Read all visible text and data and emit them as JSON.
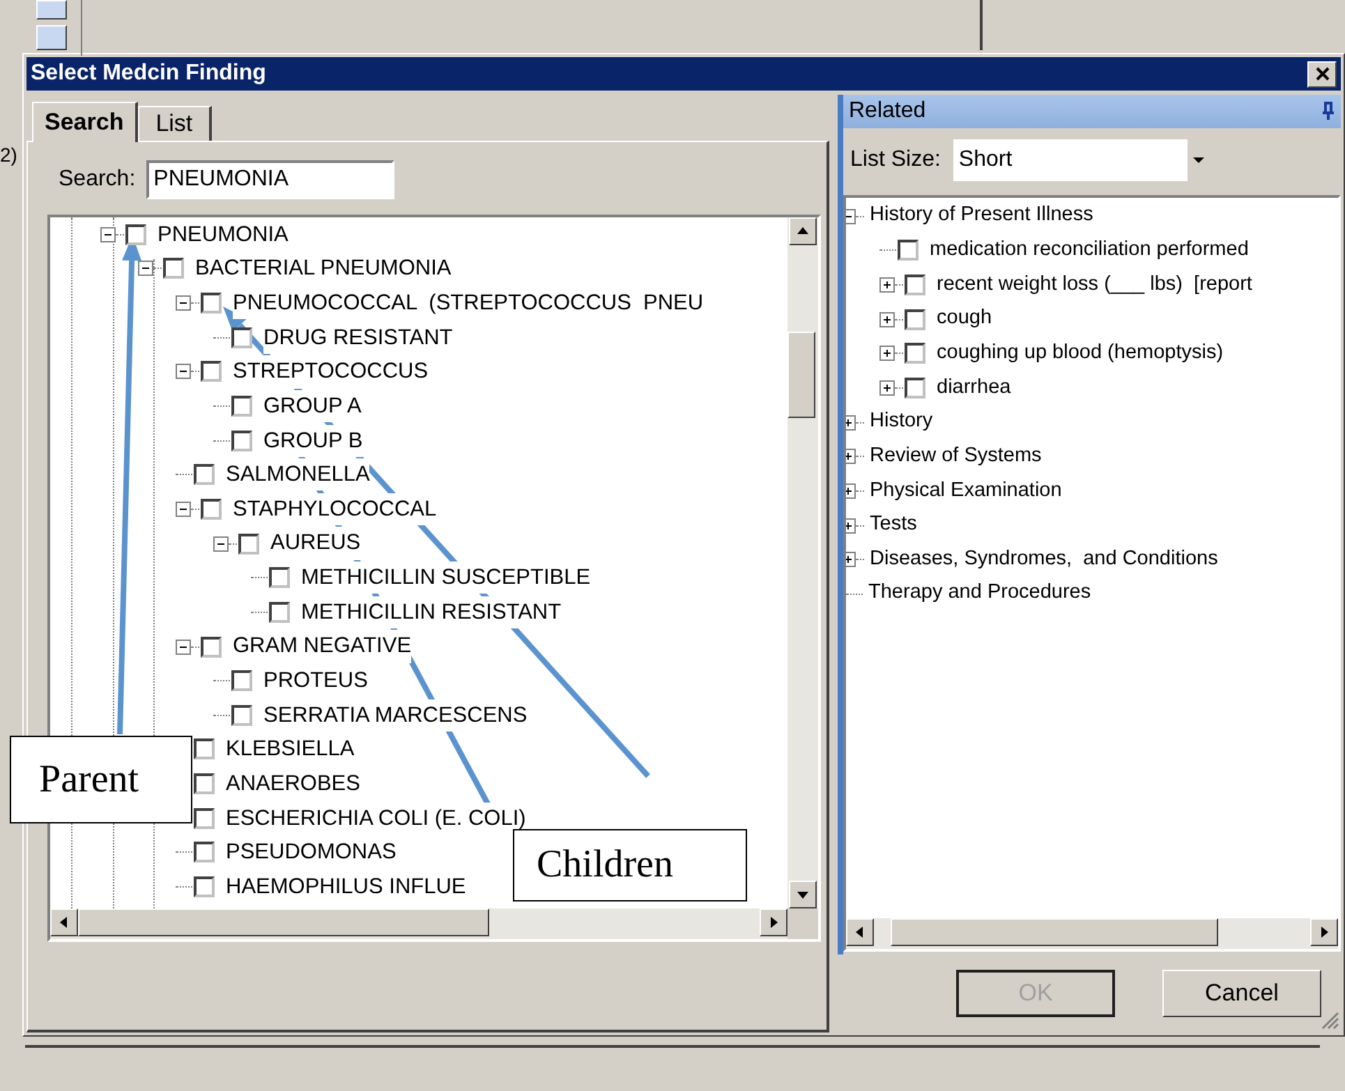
{
  "background_text": "2)",
  "window": {
    "title": "Select Medcin Finding"
  },
  "tabs": [
    {
      "label": "Search",
      "selected": true
    },
    {
      "label": "List",
      "selected": false
    }
  ],
  "search": {
    "label": "Search:",
    "value": "PNEUMONIA"
  },
  "finding_tree": [
    {
      "label": "PNEUMONIA",
      "checked": false,
      "expanded": true,
      "children": [
        {
          "label": "BACTERIAL PNEUMONIA",
          "checked": false,
          "expanded": true,
          "children": [
            {
              "label": "PNEUMOCOCCAL  (STREPTOCOCCUS  PNEU",
              "checked": false,
              "expanded": true,
              "children": [
                {
                  "label": "DRUG RESISTANT",
                  "checked": false
                }
              ]
            },
            {
              "label": "STREPTOCOCCUS",
              "checked": false,
              "expanded": true,
              "children": [
                {
                  "label": "GROUP A",
                  "checked": false
                },
                {
                  "label": "GROUP B",
                  "checked": false
                }
              ]
            },
            {
              "label": "SALMONELLA",
              "checked": false
            },
            {
              "label": "STAPHYLOCOCCAL",
              "checked": false,
              "expanded": true,
              "children": [
                {
                  "label": "AUREUS",
                  "checked": false,
                  "expanded": true,
                  "children": [
                    {
                      "label": "METHICILLIN SUSCEPTIBLE",
                      "checked": false
                    },
                    {
                      "label": "METHICILLIN RESISTANT",
                      "checked": false
                    }
                  ]
                }
              ]
            },
            {
              "label": "GRAM NEGATIVE",
              "checked": false,
              "expanded": true,
              "children": [
                {
                  "label": "PROTEUS",
                  "checked": false
                },
                {
                  "label": "SERRATIA MARCESCENS",
                  "checked": false
                }
              ]
            },
            {
              "label": "KLEBSIELLA",
              "checked": false
            },
            {
              "label": "ANAEROBES",
              "checked": false
            },
            {
              "label": "ESCHERICHIA COLI (E. COLI)",
              "checked": false
            },
            {
              "label": "PSEUDOMONAS",
              "checked": false
            },
            {
              "label": "HAEMOPHILUS INFLUE",
              "checked": false
            }
          ]
        }
      ]
    }
  ],
  "related": {
    "title": "Related",
    "list_size": {
      "label": "List Size:",
      "value": "Short"
    },
    "tree": [
      {
        "label": "History of Present Illness",
        "expanded": true,
        "children": [
          {
            "label": "medication reconciliation performed",
            "checked": false
          },
          {
            "label": "recent weight loss (___ lbs)  [report",
            "checked": false,
            "expanded": false
          },
          {
            "label": "cough",
            "checked": false,
            "expanded": false
          },
          {
            "label": "coughing up blood (hemoptysis)",
            "checked": false,
            "expanded": false
          },
          {
            "label": "diarrhea",
            "checked": false,
            "expanded": false
          }
        ]
      },
      {
        "label": "History",
        "expanded": false
      },
      {
        "label": "Review of Systems",
        "expanded": false
      },
      {
        "label": "Physical Examination",
        "expanded": false
      },
      {
        "label": "Tests",
        "expanded": false
      },
      {
        "label": "Diseases, Syndromes,  and Conditions",
        "expanded": false
      },
      {
        "label": "Therapy and Procedures"
      }
    ]
  },
  "buttons": [
    {
      "label": "OK",
      "disabled": true
    },
    {
      "label": "Cancel",
      "disabled": false
    }
  ],
  "annotations": [
    {
      "text": "Parent"
    },
    {
      "text": "Children"
    }
  ]
}
